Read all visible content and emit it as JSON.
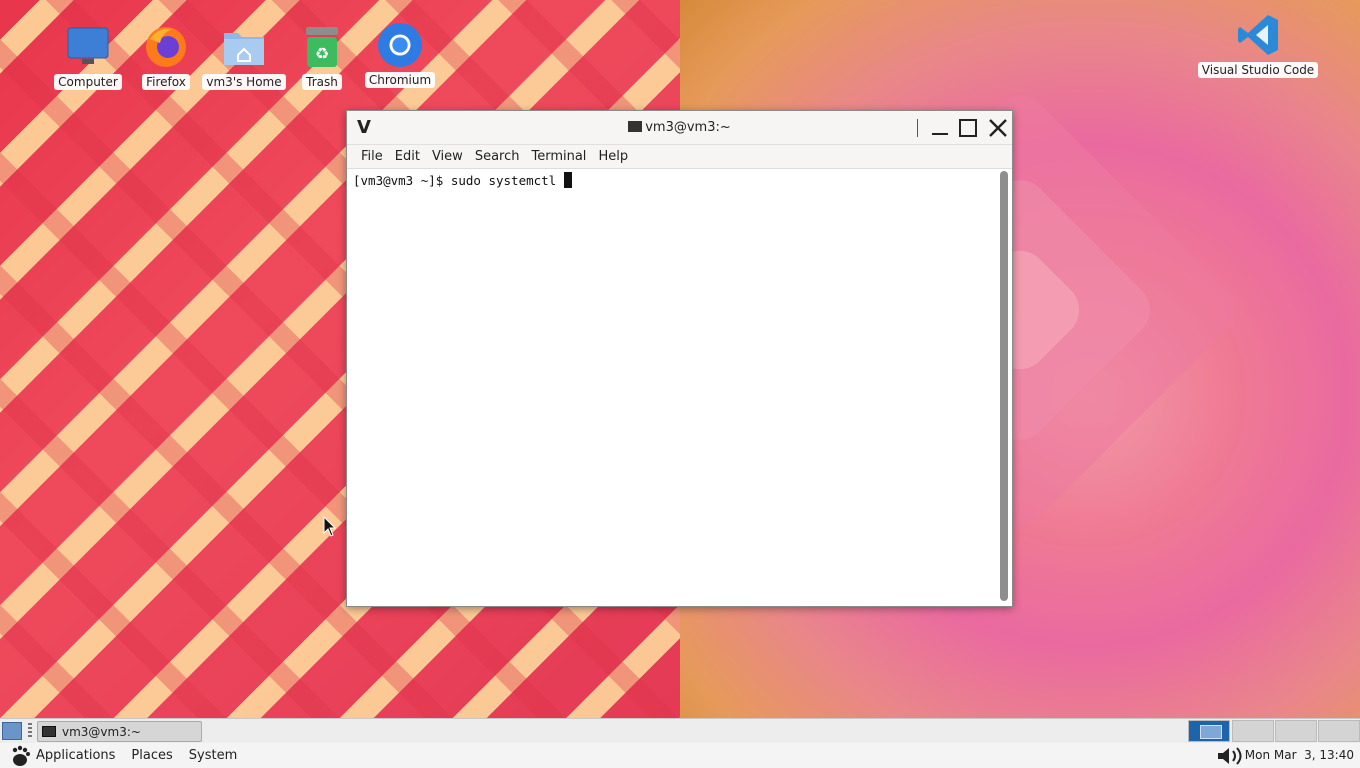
{
  "desktop": {
    "icons": [
      {
        "label": "Computer",
        "icon": "computer-icon"
      },
      {
        "label": "Firefox",
        "icon": "firefox-icon"
      },
      {
        "label": "vm3's Home",
        "icon": "home-folder-icon"
      },
      {
        "label": "Trash",
        "icon": "trash-icon"
      },
      {
        "label": "Chromium",
        "icon": "chromium-icon"
      },
      {
        "label": "Visual Studio Code",
        "icon": "vscode-icon"
      }
    ]
  },
  "window": {
    "logo": "V",
    "title": "vm3@vm3:~",
    "menu": [
      "File",
      "Edit",
      "View",
      "Search",
      "Terminal",
      "Help"
    ],
    "prompt": "[vm3@vm3 ~]$ ",
    "command": "sudo systemctl "
  },
  "taskbar": {
    "task_label": "vm3@vm3:~"
  },
  "panel": {
    "menus": [
      "Applications",
      "Places",
      "System"
    ],
    "clock": "Mon Mar  3, 13:40"
  },
  "colors": {
    "workspace_active": "#1e64a8",
    "wallpaper_red": "#e8364c",
    "wallpaper_pink": "#ef7a93"
  }
}
